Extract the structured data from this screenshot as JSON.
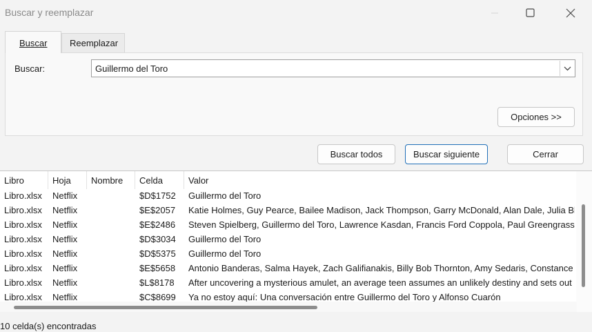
{
  "window": {
    "title": "Buscar y reemplazar"
  },
  "tabs": [
    {
      "label": "Buscar"
    },
    {
      "label": "Reemplazar"
    }
  ],
  "find": {
    "label": "Buscar:",
    "value": "Guillermo del Toro"
  },
  "buttons": {
    "options": "Opciones >>",
    "find_all": "Buscar todos",
    "find_next": "Buscar siguiente",
    "close": "Cerrar"
  },
  "results": {
    "columns": [
      "Libro",
      "Hoja",
      "Nombre",
      "Celda",
      "Valor"
    ],
    "rows": [
      [
        "Libro.xlsx",
        "Netflix",
        "",
        "$D$1752",
        "Guillermo del Toro"
      ],
      [
        "Libro.xlsx",
        "Netflix",
        "",
        "$E$2057",
        "Katie Holmes, Guy Pearce, Bailee Madison, Jack Thompson, Garry McDonald, Alan Dale, Julia Bla"
      ],
      [
        "Libro.xlsx",
        "Netflix",
        "",
        "$E$2486",
        "Steven Spielberg, Guillermo del Toro, Lawrence Kasdan, Francis Ford Coppola, Paul Greengrass,"
      ],
      [
        "Libro.xlsx",
        "Netflix",
        "",
        "$D$3034",
        "Guillermo del Toro"
      ],
      [
        "Libro.xlsx",
        "Netflix",
        "",
        "$D$5375",
        "Guillermo del Toro"
      ],
      [
        "Libro.xlsx",
        "Netflix",
        "",
        "$E$5658",
        "Antonio Banderas, Salma Hayek, Zach Galifianakis, Billy Bob Thornton, Amy Sedaris, Constance M"
      ],
      [
        "Libro.xlsx",
        "Netflix",
        "",
        "$L$8178",
        "After uncovering a mysterious amulet, an average teen assumes an unlikely destiny and sets out"
      ],
      [
        "Libro.xlsx",
        "Netflix",
        "",
        "$C$8699",
        "Ya no estoy aquí: Una conversación entre Guillermo del Toro y Alfonso Cuarón"
      ]
    ]
  },
  "status": "10 celda(s) encontradas",
  "colors": {
    "accent": "#1f6fb8",
    "title_text": "#8a8a8a",
    "background": "#f3f3f3"
  }
}
